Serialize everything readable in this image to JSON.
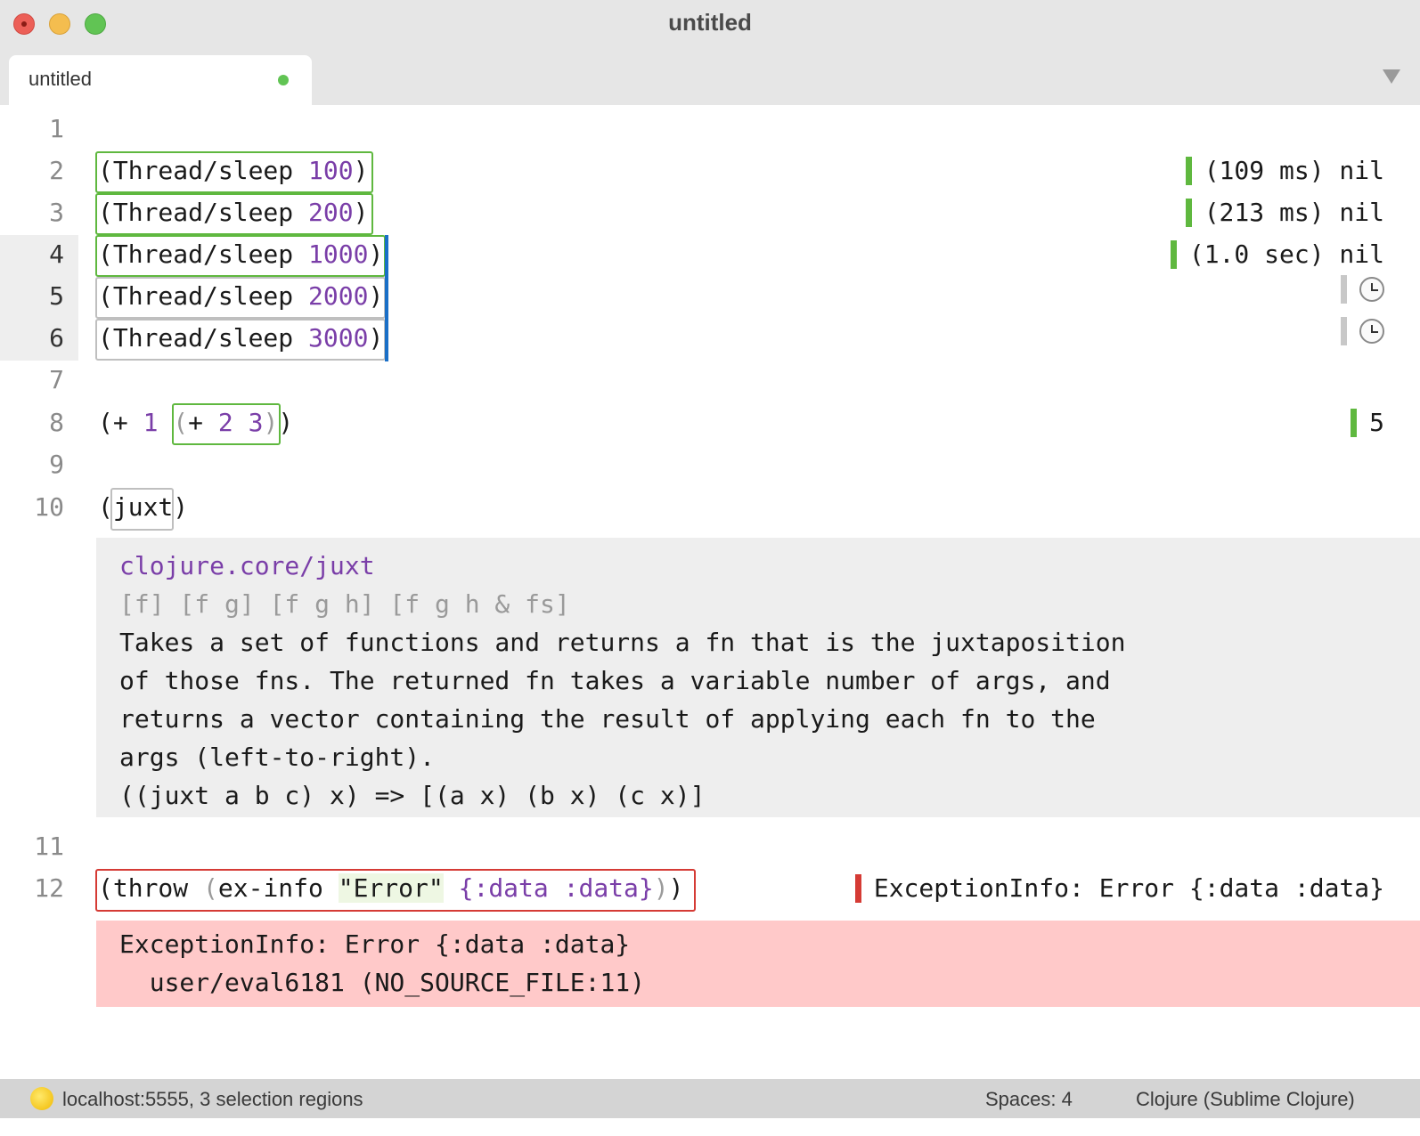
{
  "window": {
    "title": "untitled"
  },
  "tab": {
    "label": "untitled"
  },
  "line_numbers": [
    "1",
    "2",
    "3",
    "4",
    "5",
    "6",
    "7",
    "8",
    "9",
    "10",
    "11",
    "12"
  ],
  "code": {
    "l2": {
      "open": "(Thread/sleep ",
      "num": "100",
      "close": ")"
    },
    "l3": {
      "open": "(Thread/sleep ",
      "num": "200",
      "close": ")"
    },
    "l4": {
      "open": "(Thread/sleep ",
      "num": "1000",
      "close": ")"
    },
    "l5": {
      "open": "(Thread/sleep ",
      "num": "2000",
      "close": ")"
    },
    "l6": {
      "open": "(Thread/sleep ",
      "num": "3000",
      "close": ")"
    },
    "l8": {
      "a": "(+ ",
      "n1": "1",
      "sp": " ",
      "inner_open": "(",
      "plus": "+ ",
      "n2": "2",
      "sp2": " ",
      "n3": "3",
      "inner_close": ")",
      "close": ")"
    },
    "l10": {
      "open": "(",
      "name": "juxt",
      "close": ")"
    },
    "l12": {
      "a": "(throw ",
      "b": "(",
      "c": "ex-info ",
      "str": "\"Error\"",
      "sp": " ",
      "map": "{:data :data}",
      "d": ")",
      "e": ")"
    }
  },
  "results": {
    "r2": "(109 ms) nil",
    "r3": "(213 ms) nil",
    "r4": "(1.0 sec) nil",
    "r8": "5",
    "r12": "ExceptionInfo: Error {:data :data}"
  },
  "doc": {
    "name": "clojure.core/juxt",
    "args": "[f] [f g] [f g h] [f g h & fs]",
    "lines": [
      "Takes a set of functions and returns a fn that is the juxtaposition",
      "of those fns. The returned fn takes a variable number of args, and",
      "returns a vector containing the result of applying each fn to the",
      "args (left-to-right).",
      "((juxt a b c) x) => [(a x) (b x) (c x)]"
    ]
  },
  "error": {
    "lines": [
      "ExceptionInfo: Error {:data :data}",
      "  user/eval6181 (NO_SOURCE_FILE:11)"
    ]
  },
  "status": {
    "left": "localhost:5555, 3 selection regions",
    "spaces": "Spaces: 4",
    "syntax": "Clojure (Sublime Clojure)"
  },
  "colors": {
    "accent_green": "#5fb83f",
    "error_red": "#d53b35",
    "number_purple": "#7a3ea8"
  }
}
